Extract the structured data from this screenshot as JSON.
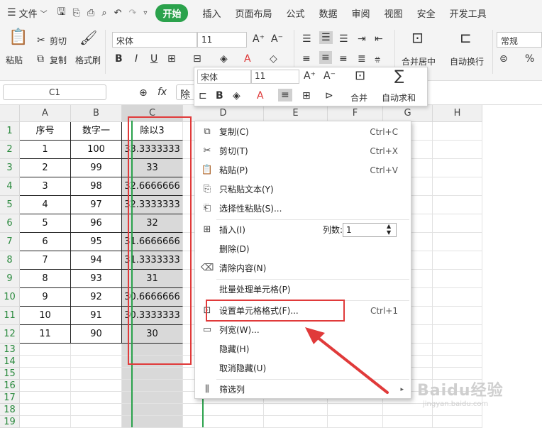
{
  "menubar": {
    "file_label": "文件",
    "tabs": [
      "开始",
      "插入",
      "页面布局",
      "公式",
      "数据",
      "审阅",
      "视图",
      "安全",
      "开发工具"
    ],
    "active_tab": "开始"
  },
  "ribbon": {
    "paste": "粘贴",
    "cut": "剪切",
    "copy": "复制",
    "format_painter": "格式刷",
    "font_name": "宋体",
    "font_size": "11",
    "merge_center": "合并居中",
    "wrap_text": "自动换行",
    "number_format": "常规"
  },
  "formula_bar": {
    "cell_ref": "C1",
    "fx": "fx",
    "content": "除"
  },
  "columns": [
    "A",
    "B",
    "C",
    "D",
    "E",
    "F",
    "G",
    "H"
  ],
  "rows": [
    "1",
    "2",
    "3",
    "4",
    "5",
    "6",
    "7",
    "8",
    "9",
    "10",
    "11",
    "12",
    "13",
    "14",
    "15",
    "16",
    "17",
    "18",
    "19"
  ],
  "table": [
    [
      "序号",
      "数字一",
      "除以3"
    ],
    [
      "1",
      "100",
      "33.3333333"
    ],
    [
      "2",
      "99",
      "33"
    ],
    [
      "3",
      "98",
      "32.6666666"
    ],
    [
      "4",
      "97",
      "32.3333333"
    ],
    [
      "5",
      "96",
      "32"
    ],
    [
      "6",
      "95",
      "31.6666666"
    ],
    [
      "7",
      "94",
      "31.3333333"
    ],
    [
      "8",
      "93",
      "31"
    ],
    [
      "9",
      "92",
      "30.6666666"
    ],
    [
      "10",
      "91",
      "30.3333333"
    ],
    [
      "11",
      "90",
      "30"
    ]
  ],
  "mini_toolbar": {
    "font_name": "宋体",
    "font_size": "11",
    "merge": "合并",
    "autosum": "自动求和"
  },
  "context_menu": {
    "copy": {
      "label": "复制(C)",
      "shortcut": "Ctrl+C"
    },
    "cut": {
      "label": "剪切(T)",
      "shortcut": "Ctrl+X"
    },
    "paste": {
      "label": "粘贴(P)",
      "shortcut": "Ctrl+V"
    },
    "paste_text": {
      "label": "只粘贴文本(Y)"
    },
    "paste_special": {
      "label": "选择性粘贴(S)..."
    },
    "insert": {
      "label": "插入(I)",
      "count_label": "列数:",
      "count_value": "1"
    },
    "delete": {
      "label": "删除(D)"
    },
    "clear": {
      "label": "清除内容(N)"
    },
    "batch": {
      "label": "批量处理单元格(P)"
    },
    "format_cells": {
      "label": "设置单元格格式(F)...",
      "shortcut": "Ctrl+1"
    },
    "col_width": {
      "label": "列宽(W)..."
    },
    "hide": {
      "label": "隐藏(H)"
    },
    "unhide": {
      "label": "取消隐藏(U)"
    },
    "filter": {
      "label": "筛选列"
    }
  },
  "watermark": {
    "text": "Baidu经验",
    "sub": "jingyan.baidu.com"
  },
  "colors": {
    "accent": "#2ba24c",
    "highlight": "#e03a3a",
    "selection": "#d9d9d9"
  }
}
